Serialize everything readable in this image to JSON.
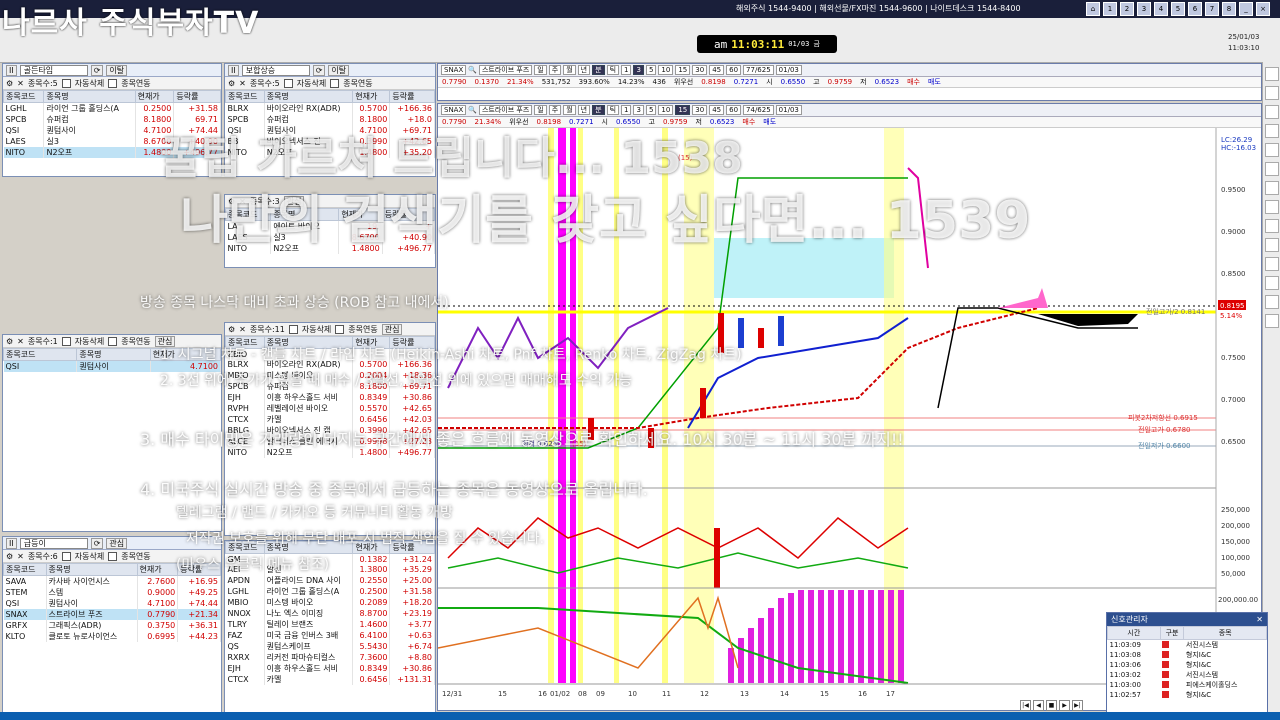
{
  "brand": "나르사 주식부자TV",
  "hotlines": "해외주식 1544-9400 | 해외선물/FX마진 1544-9600 | 나이트데스크 1544-8400",
  "top_pages": [
    "1",
    "2",
    "3",
    "4",
    "5",
    "6",
    "7",
    "8"
  ],
  "clock": {
    "ampm": "am",
    "time": "11:03:11",
    "date": "01/03 금"
  },
  "date_right": {
    "date": "25/01/03",
    "time": "11:03:10"
  },
  "panels": {
    "p1": {
      "group": "골든타임",
      "count_label": "종목수:5",
      "auto_delete": "자동삭제",
      "link": "종목연동",
      "tab": "이탈",
      "headers": [
        "종목코드",
        "종목명",
        "현재가",
        "등락률"
      ],
      "rows": [
        [
          "LGHL",
          "라이언 그룹 홀딩스(A",
          "0.2500",
          "+31.58"
        ],
        [
          "SPCB",
          "슈퍼컴",
          "8.1800",
          "69.71"
        ],
        [
          "QSI",
          "퀀텀사이",
          "4.7100",
          "+74.44"
        ],
        [
          "LAES",
          "실3",
          "8.6700",
          "+40.90"
        ],
        [
          "NITO",
          "N2오프",
          "1.4800",
          "+496.77"
        ]
      ]
    },
    "p2": {
      "group": "보합상승",
      "count_label": "종목수:5",
      "auto_delete": "자동삭제",
      "link": "종목연동",
      "tab": "이탈",
      "headers": [
        "종목코드",
        "종목명",
        "현재가",
        "등락률"
      ],
      "rows": [
        [
          "BLRX",
          "바이오라인 RX(ADR)",
          "0.5700",
          "+166.36"
        ],
        [
          "SPCB",
          "슈퍼컴",
          "8.1800",
          "+18.0"
        ],
        [
          "QSI",
          "퀀텀사이",
          "4.7100",
          "+69.71"
        ],
        [
          "BB",
          "바이오넥서스 진",
          "0.3990",
          "+42.65"
        ],
        [
          "NITO",
          "N2오프",
          "1.4800",
          "+35.20"
        ]
      ]
    },
    "p3": {
      "count_label": "종목수:1",
      "auto_delete": "자동삭제",
      "link": "종목연동",
      "tab": "관심",
      "headers": [
        "종목코드",
        "종목명",
        "현재가"
      ],
      "rows": [
        [
          "QSI",
          "퀀텀사이",
          "4.7100"
        ]
      ]
    },
    "p4": {
      "count_label": "종목수:3",
      "tab": "관심",
      "headers": [
        "종목코드",
        "종목명",
        "현재가",
        "등락률"
      ],
      "rows": [
        [
          "LA",
          "에이트 바이오",
          "19.",
          "+"
        ],
        [
          "LAES",
          "실3",
          "8.6700",
          "+40.90"
        ],
        [
          "NITO",
          "N2오프",
          "1.4800",
          "+496.77"
        ]
      ]
    },
    "p5": {
      "count_label": "종목수:11",
      "auto_delete": "자동삭제",
      "link": "종목연동",
      "tab": "관심",
      "headers": [
        "종목코드",
        "종목명",
        "현재가",
        "등락률"
      ],
      "rows": [
        [
          "ZBIO",
          "",
          "",
          ""
        ],
        [
          "BLRX",
          "바이오라인 RX(ADR)",
          "0.5700",
          "+166.36"
        ],
        [
          "MBIO",
          "미스텡 바이오",
          "0.2004",
          "+18.36"
        ],
        [
          "SPCB",
          "슈퍼컴",
          "8.1800",
          "+69.71"
        ],
        [
          "EJH",
          "이흥 하우스홀드 서비",
          "0.8349",
          "+30.86"
        ],
        [
          "RVPH",
          "레벨레이션 바이오",
          "0.5570",
          "+42.65"
        ],
        [
          "CTCX",
          "카멜",
          "0.6456",
          "+42.03"
        ],
        [
          "BBLG",
          "바이오넥서스 진 캡",
          "0.3990",
          "+42.65"
        ],
        [
          "ALCE",
          "알터너스 클린 에너지",
          "0.9998",
          "+27.23"
        ],
        [
          "NITO",
          "N2오프",
          "1.4800",
          "+496.77"
        ]
      ]
    },
    "p6": {
      "group": "급등이",
      "count_label": "종목수:6",
      "auto_delete": "자동삭제",
      "link": "종목연동",
      "tab": "관심",
      "headers": [
        "종목코드",
        "종목명",
        "현재가",
        "등락률"
      ],
      "rows": [
        [
          "SAVA",
          "카사바 사이언시스",
          "2.7600",
          "+16.95"
        ],
        [
          "STEM",
          "스템",
          "0.9000",
          "+49.25"
        ],
        [
          "QSI",
          "퀀텀사이",
          "4.7100",
          "+74.44"
        ],
        [
          "SNAX",
          "스트라이브 푸즈",
          "0.7790",
          "+21.34"
        ],
        [
          "GRFX",
          "그래픽스(ADR)",
          "0.3750",
          "+36.31"
        ],
        [
          "KLTO",
          "클로토 뉴로사이언스",
          "0.6995",
          "+44.23"
        ]
      ]
    },
    "p7": {
      "count_label": "종목수:2",
      "tab": "관심",
      "headers": [
        "종목코드",
        "종목명",
        "현재가",
        "등락률"
      ],
      "rows": [
        [
          "GM",
          "",
          "0.1382",
          "+31.24"
        ],
        [
          "AEI",
          "알센",
          "1.3800",
          "+35.29"
        ],
        [
          "APDN",
          "어플라이드 DNA 사이",
          "0.2550",
          "+25.00"
        ],
        [
          "LGHL",
          "라이언 그룹 홀딩스(A",
          "0.2500",
          "+31.58"
        ],
        [
          "MBIO",
          "미스텡 바이오",
          "0.2089",
          "+18.20"
        ],
        [
          "NNOX",
          "나노 엑스 이미징",
          "8.8700",
          "+23.19"
        ],
        [
          "TLRY",
          "틸레이 브랜즈",
          "1.4600",
          "+3.77"
        ],
        [
          "FAZ",
          "미국 금융 인버스 3배",
          "6.4100",
          "+0.63"
        ],
        [
          "QS",
          "퀀텀스케이프",
          "5.5430",
          "+6.74"
        ],
        [
          "RXRX",
          "리커전 파마슈티컬스",
          "7.3600",
          "+8.80"
        ],
        [
          "EJH",
          "이흥 하우스홀드 서비",
          "0.8349",
          "+30.86"
        ],
        [
          "CTCX",
          "카멜",
          "0.6456",
          "+131.31"
        ]
      ]
    }
  },
  "chart_top": {
    "symbol": "SNAX",
    "name": "스트라이브 푸즈",
    "periods": [
      "일",
      "주",
      "월",
      "년",
      "분",
      "틱",
      "1",
      "3",
      "5",
      "10",
      "15",
      "30",
      "45",
      "60"
    ],
    "count": "77/625",
    "date": "01/03",
    "quote": [
      "0.7790",
      "0.1370",
      "21.34%",
      "531,752",
      "393.60%",
      "14.23%",
      "436",
      "위우선",
      "0.8198",
      "0.7271",
      "시",
      "0.6550",
      "고",
      "0.9759",
      "저",
      "0.6523",
      "매수",
      "매도"
    ]
  },
  "chart_main": {
    "symbol": "SNAX",
    "name": "스트라이브 푸즈",
    "periods": [
      "일",
      "주",
      "월",
      "년",
      "분",
      "틱",
      "1",
      "3",
      "5",
      "10",
      "15",
      "30",
      "45",
      "60"
    ],
    "count": "74/625",
    "date": "01/03",
    "quote": [
      "0.7790",
      "21.34%",
      "위우선",
      "0.8198",
      "0.7271",
      "시",
      "0.6550",
      "고",
      "0.9759",
      "저",
      "0.6523",
      "매수",
      "매도"
    ]
  },
  "y_axis": [
    "0.9500",
    "0.9000",
    "0.8500",
    "0.8000",
    "0.7500",
    "0.7000",
    "0.6500"
  ],
  "y_axis_vol": [
    "250,000",
    "200,000",
    "150,000",
    "100,000",
    "50,000"
  ],
  "y_axis_bottom": "200,000.00",
  "price_tag": "0.8195",
  "price_tag_pct": "5.14%",
  "lc_hc": [
    "LC:26.29",
    "HC:-16.03"
  ],
  "level_labels": [
    "전일고가/2 0.8141",
    "피봇2차저항선 0.6915",
    "전일고가 0.6780",
    "전일저가 0.6600"
  ],
  "chart_notes": [
    "(15)",
    "최저 0.6250",
    "(15)"
  ],
  "x_axis": [
    "12/31",
    "15",
    "16",
    "01/02",
    "08",
    "09",
    "10",
    "11",
    "12",
    "13",
    "14",
    "15",
    "16",
    "17"
  ],
  "chart_data": {
    "type": "line",
    "note": "intraday candles + indicator lines of SNAX, approximate",
    "y_range": [
      0.63,
      0.98
    ],
    "price_series": [
      0.67,
      0.67,
      0.68,
      0.67,
      0.68,
      0.66,
      0.67,
      0.68,
      0.66,
      0.67,
      0.72,
      0.77,
      0.79,
      0.78,
      0.8,
      0.81,
      0.8,
      0.81,
      0.82,
      0.82
    ]
  },
  "overlay": {
    "line1": "꿀팁 가르쳐 드립니다... 1538",
    "line2": "나만의 검색기를 갖고 싶다면... 1539",
    "line3": "방송 종목 나스닥 대비 초과 상승 (ROB 참고 내에서)",
    "line4": "1. 시그널 차트 - 캔들 차트 / 라인 차트 (Heikin-Ashi 차트, Pnf 차트, Renko 차트, ZigZag 차트)",
    "line5": "2. 3선 위에 주가가 있을 때 매수 / 3일선, 5일선 위에 있으면 매매해도 수익 가능",
    "line6": "3. 매수 타이밍은 거래량이 터지는 구간에서 좋은 흐름에 동영상으로 확인하세요. 10시 30분 ~ 11시 30분 까지!!",
    "line7": "4. 미국주식 실시간 방송 중 종목에서 급등하는 종목은 동영상으로 올립니다.",
    "line8": "텔레그램 / 밴드 / 카카오 등 커뮤니티 활동 개방",
    "line9": "저작권 보호를 위해 무단 배포 시 법적 책임을 질 수 있습니다.",
    "line10": "(마우스 우클릭 메뉴 참조)"
  },
  "alerts": {
    "title": "신호관리자",
    "headers": [
      "시간",
      "구분",
      "종목"
    ],
    "rows": [
      [
        "11:03:09",
        "서진시스템"
      ],
      [
        "11:03:08",
        "형지I&C"
      ],
      [
        "11:03:06",
        "형지I&C"
      ],
      [
        "11:03:02",
        "서진시스템"
      ],
      [
        "11:03:00",
        "피에스케이홀딩스"
      ],
      [
        "11:02:57",
        "형지I&C"
      ]
    ]
  }
}
